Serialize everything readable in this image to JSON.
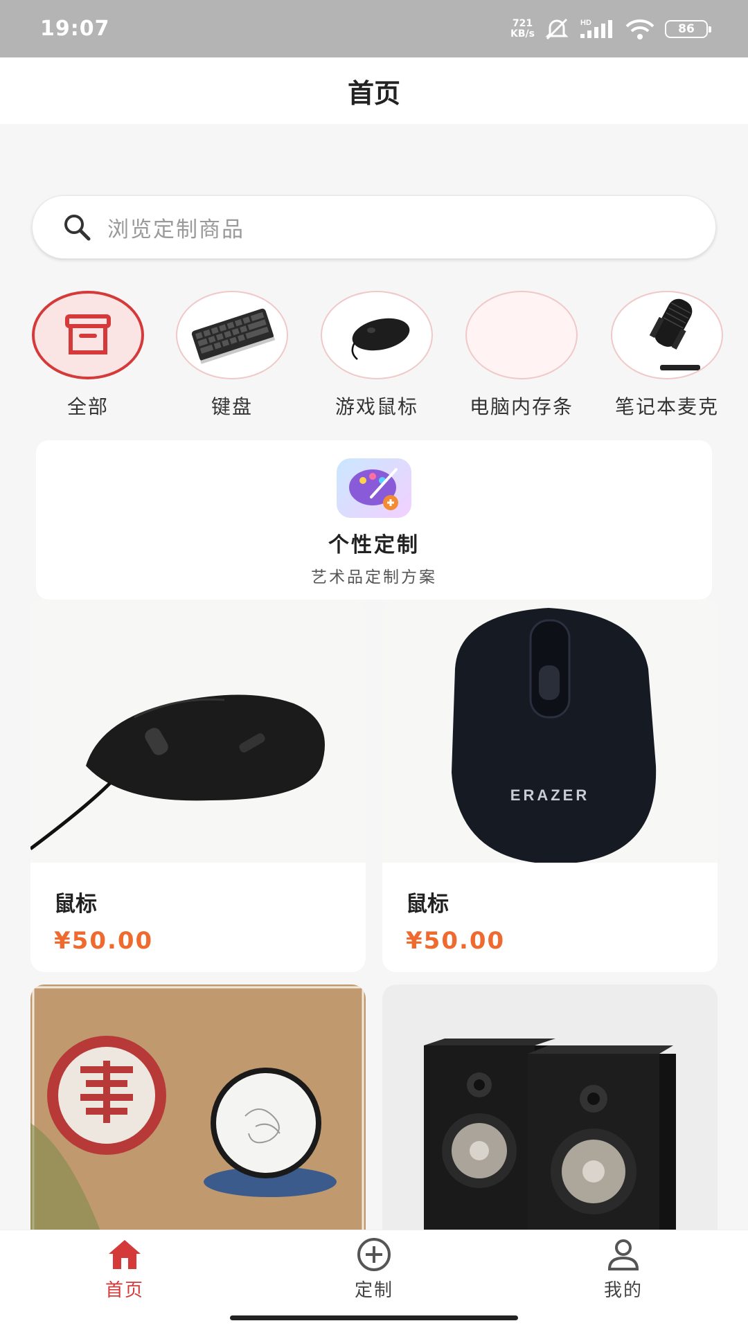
{
  "status": {
    "time": "19:07",
    "net_speed_value": "721",
    "net_speed_unit": "KB/s",
    "signal_badge": "HD",
    "battery": "86"
  },
  "header": {
    "title": "首页"
  },
  "search": {
    "placeholder": "浏览定制商品"
  },
  "categories": [
    {
      "label": "全部",
      "icon": "box-icon"
    },
    {
      "label": "键盘",
      "icon": "keyboard-image"
    },
    {
      "label": "游戏鼠标",
      "icon": "mouse-image"
    },
    {
      "label": "电脑内存条",
      "icon": "empty"
    },
    {
      "label": "笔记本麦克",
      "icon": "microphone-image"
    }
  ],
  "custom_banner": {
    "title": "个性定制",
    "subtitle": "艺术品定制方案"
  },
  "products": [
    {
      "name": "鼠标",
      "price": "¥50.00",
      "image": "wired-gaming-mouse"
    },
    {
      "name": "鼠标",
      "price": "¥50.00",
      "image": "erazer-wireless-mouse",
      "brand_text": "ERAZER"
    },
    {
      "image": "seal-artwork"
    },
    {
      "image": "bookshelf-speakers"
    }
  ],
  "tabbar": {
    "items": [
      {
        "label": "首页",
        "icon": "home-icon",
        "active": true
      },
      {
        "label": "定制",
        "icon": "plus-circle-icon",
        "active": false
      },
      {
        "label": "我的",
        "icon": "user-icon",
        "active": false
      }
    ]
  },
  "colors": {
    "accent": "#d43a3a",
    "price": "#ee6a2e",
    "status_bar": "#b4b4b4"
  }
}
